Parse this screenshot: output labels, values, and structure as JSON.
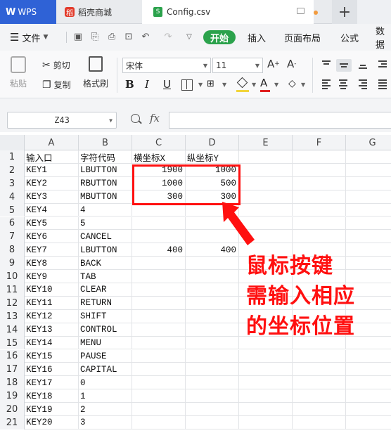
{
  "tabs": {
    "wps_logo": "W",
    "wps_label": "WPS",
    "store_icon": "稻",
    "store_label": "稻壳商城",
    "config_icon": "S",
    "config_label": "Config.csv",
    "add_label": "+"
  },
  "menu": {
    "file_label": "文件",
    "start_label": "开始",
    "insert_label": "插入",
    "layout_label": "页面布局",
    "formula_label": "公式",
    "data_label": "数据"
  },
  "ribbon": {
    "paste_label": "粘贴",
    "cut_label": "剪切",
    "copy_label": "复制",
    "format_painter_label": "格式刷",
    "font_name": "宋体",
    "font_size": "11",
    "bold": "B",
    "italic": "I",
    "underline": "U",
    "font_color": "A"
  },
  "formula_bar": {
    "cell_ref": "Z43",
    "fx": "fx"
  },
  "sheet": {
    "columns": [
      "A",
      "B",
      "C",
      "D",
      "E",
      "F",
      "G"
    ],
    "rows": [
      {
        "n": "1",
        "a": "输入口",
        "b": "字符代码",
        "c": "横坐标X",
        "d": "纵坐标Y"
      },
      {
        "n": "2",
        "a": "KEY1",
        "b": "LBUTTON",
        "c": "1900",
        "d": "1000"
      },
      {
        "n": "3",
        "a": "KEY2",
        "b": "RBUTTON",
        "c": "1000",
        "d": "500"
      },
      {
        "n": "4",
        "a": "KEY3",
        "b": "MBUTTON",
        "c": "300",
        "d": "300"
      },
      {
        "n": "5",
        "a": "KEY4",
        "b": "4",
        "c": "",
        "d": ""
      },
      {
        "n": "6",
        "a": "KEY5",
        "b": "5",
        "c": "",
        "d": ""
      },
      {
        "n": "7",
        "a": "KEY6",
        "b": "CANCEL",
        "c": "",
        "d": ""
      },
      {
        "n": "8",
        "a": "KEY7",
        "b": "LBUTTON",
        "c": "400",
        "d": "400"
      },
      {
        "n": "9",
        "a": "KEY8",
        "b": "BACK",
        "c": "",
        "d": ""
      },
      {
        "n": "10",
        "a": "KEY9",
        "b": "TAB",
        "c": "",
        "d": ""
      },
      {
        "n": "11",
        "a": "KEY10",
        "b": "CLEAR",
        "c": "",
        "d": ""
      },
      {
        "n": "12",
        "a": "KEY11",
        "b": "RETURN",
        "c": "",
        "d": ""
      },
      {
        "n": "13",
        "a": "KEY12",
        "b": "SHIFT",
        "c": "",
        "d": ""
      },
      {
        "n": "14",
        "a": "KEY13",
        "b": "CONTROL",
        "c": "",
        "d": ""
      },
      {
        "n": "15",
        "a": "KEY14",
        "b": "MENU",
        "c": "",
        "d": ""
      },
      {
        "n": "16",
        "a": "KEY15",
        "b": "PAUSE",
        "c": "",
        "d": ""
      },
      {
        "n": "17",
        "a": "KEY16",
        "b": "CAPITAL",
        "c": "",
        "d": ""
      },
      {
        "n": "18",
        "a": "KEY17",
        "b": "0",
        "c": "",
        "d": ""
      },
      {
        "n": "19",
        "a": "KEY18",
        "b": "1",
        "c": "",
        "d": ""
      },
      {
        "n": "20",
        "a": "KEY19",
        "b": "2",
        "c": "",
        "d": ""
      },
      {
        "n": "21",
        "a": "KEY20",
        "b": "3",
        "c": "",
        "d": ""
      }
    ]
  },
  "annotation": {
    "lines": [
      "鼠标按键",
      "需输入相应",
      "的坐标位置"
    ],
    "color": "#ff1010"
  },
  "colors": {
    "wps_blue": "#2f62d6",
    "start_green": "#2ba24c",
    "highlight_red": "#ff1010"
  }
}
